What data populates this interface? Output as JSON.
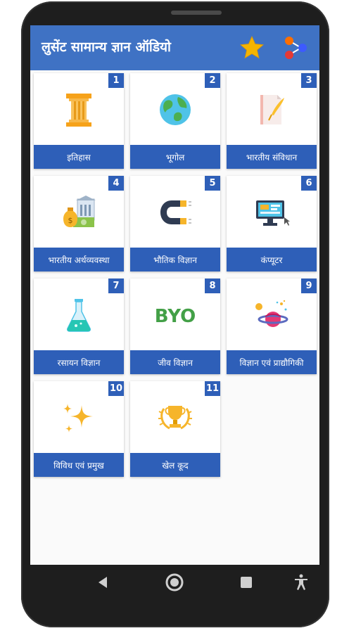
{
  "app": {
    "title": "लुसेंट सामान्य ज्ञान ऑडियो",
    "colors": {
      "appbar": "#3f72c4",
      "tile_label": "#2e5fb8",
      "star": "#f4b400"
    }
  },
  "categories": [
    {
      "number": "1",
      "label": "इतिहास",
      "icon": "pillar-icon"
    },
    {
      "number": "2",
      "label": "भूगोल",
      "icon": "globe-icon"
    },
    {
      "number": "3",
      "label": "भारतीय संविधान",
      "icon": "document-quill-icon"
    },
    {
      "number": "4",
      "label": "भारतीय अर्थव्यवस्था",
      "icon": "money-bank-icon"
    },
    {
      "number": "5",
      "label": "भौतिक विज्ञान",
      "icon": "magnet-icon"
    },
    {
      "number": "6",
      "label": "कंप्यूटर",
      "icon": "computer-icon"
    },
    {
      "number": "7",
      "label": "रसायन विज्ञान",
      "icon": "flask-icon"
    },
    {
      "number": "8",
      "label": "जीव विज्ञान",
      "icon": "bio-icon"
    },
    {
      "number": "9",
      "label": "विज्ञान एवं प्राद्यौगिकी",
      "icon": "planet-icon"
    },
    {
      "number": "10",
      "label": "विविध एवं प्रमुख",
      "icon": "sparkles-icon"
    },
    {
      "number": "11",
      "label": "खेल कूद",
      "icon": "trophy-icon"
    }
  ],
  "bio_icon_text": "BYO"
}
